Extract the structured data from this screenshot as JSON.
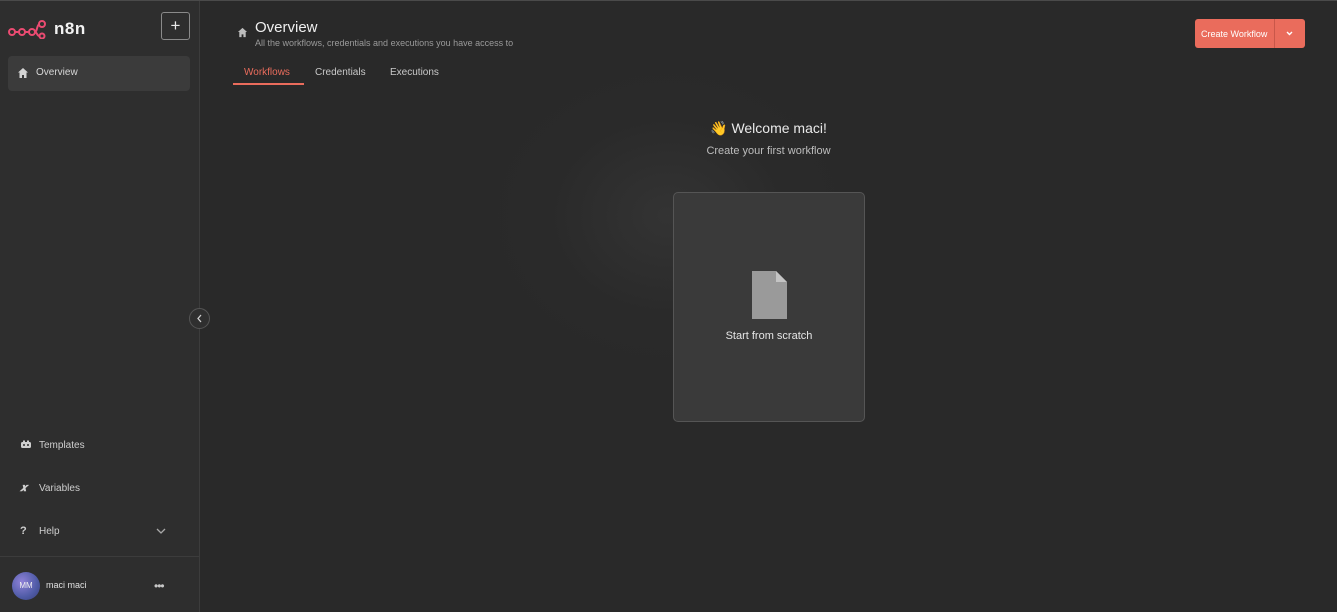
{
  "app": {
    "brand": "n8n",
    "new_button": "+"
  },
  "sidebar": {
    "overview_label": "Overview",
    "templates_label": "Templates",
    "variables_label": "Variables",
    "help_label": "Help",
    "user": {
      "initials": "MM",
      "name": "maci maci",
      "menu": "•••"
    }
  },
  "header": {
    "title": "Overview",
    "subtitle": "All the workflows, credentials and executions you have access to",
    "create_button": "Create Workflow"
  },
  "tabs": [
    {
      "label": "Workflows",
      "active": true
    },
    {
      "label": "Credentials",
      "active": false
    },
    {
      "label": "Executions",
      "active": false
    }
  ],
  "welcome": {
    "emoji": "👋",
    "title": "Welcome maci!",
    "subtitle": "Create your first workflow",
    "card_label": "Start from scratch"
  },
  "colors": {
    "accent": "#ea6c5c",
    "background": "#2a2a2a",
    "sidebar": "#2e2e2e",
    "card": "#3a3a3a"
  },
  "icons": [
    "n8n-logo-icon",
    "plus-icon",
    "home-icon",
    "templates-icon",
    "variables-icon",
    "help-icon",
    "chevron-down-icon",
    "chevron-left-icon",
    "file-icon",
    "ellipsis-icon"
  ]
}
